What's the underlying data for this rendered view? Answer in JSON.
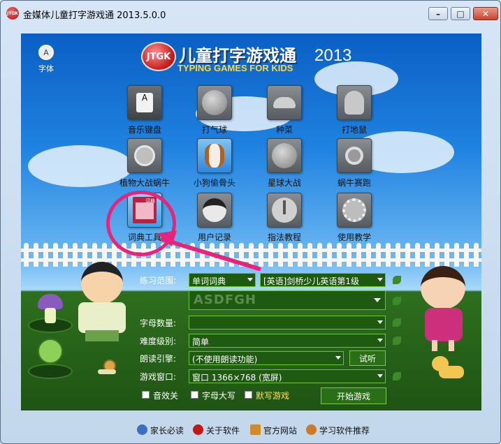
{
  "window": {
    "title": "金媒体儿童打字游戏通 2013.5.0.0",
    "icon_text": "JTGK"
  },
  "top_controls": {
    "font_label": "字体",
    "font_glyph": "A"
  },
  "logo": {
    "badge": "JTGK",
    "title": "儿童打字游戏通",
    "year": "2013",
    "subtitle": "TYPING GAMES FOR KIDS"
  },
  "games": [
    {
      "label": "音乐键盘",
      "icon": "music-keyboard-icon"
    },
    {
      "label": "打气球",
      "icon": "balloon-icon"
    },
    {
      "label": "种菜",
      "icon": "mushroom-icon"
    },
    {
      "label": "打地鼠",
      "icon": "mole-icon"
    },
    {
      "label": "植物大战蜗牛",
      "icon": "plant-shooter-icon"
    },
    {
      "label": "小狗偷骨头",
      "icon": "dog-icon"
    },
    {
      "label": "星球大战",
      "icon": "planet-icon"
    },
    {
      "label": "蜗牛赛跑",
      "icon": "snail-icon"
    },
    {
      "label": "词典工具",
      "icon": "dictionary-icon",
      "icon_text": "词典"
    },
    {
      "label": "用户记录",
      "icon": "police-user-icon"
    },
    {
      "label": "指法教程",
      "icon": "finger-icon"
    },
    {
      "label": "使用教学",
      "icon": "film-reel-icon"
    }
  ],
  "settings": {
    "range_label": "练习范围:",
    "range_value": "单词词典",
    "range_sub_value": "[英语]剑桥少儿英语第1级",
    "preview_text": "ASDFGH",
    "letters_label": "字母数量:",
    "letters_value": "",
    "difficulty_label": "难度级别:",
    "difficulty_value": "简单",
    "engine_label": "朗读引擎:",
    "engine_value": "(不使用朗读功能)",
    "listen_button": "试听",
    "window_label": "游戏窗口:",
    "window_value": "窗口 1366×768 (宽屏)"
  },
  "checks": [
    {
      "label": "音效关",
      "checked": false
    },
    {
      "label": "字母大写",
      "checked": false
    },
    {
      "label": "默写游戏",
      "checked": false
    }
  ],
  "start_button": "开始游戏",
  "footer": [
    {
      "label": "家长必读",
      "icon": "help-icon",
      "color": "#3a6fc4"
    },
    {
      "label": "关于软件",
      "icon": "jtgk-icon",
      "color": "#c21717"
    },
    {
      "label": "官方网站",
      "icon": "home-icon",
      "color": "#d08a2a"
    },
    {
      "label": "学习软件推荐",
      "icon": "recommend-icon",
      "color": "#c97a2a"
    }
  ]
}
